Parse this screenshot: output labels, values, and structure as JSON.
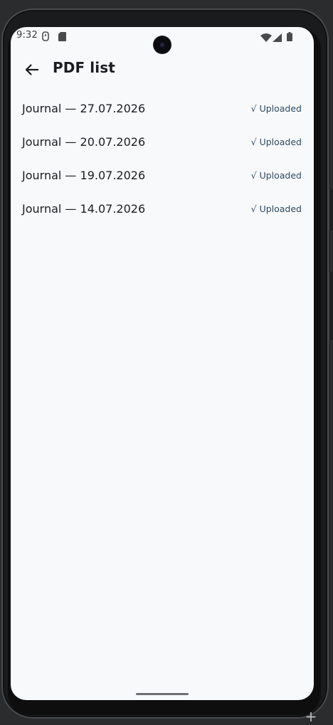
{
  "status_bar": {
    "time": "9:32",
    "left_icons": [
      "usb-icon",
      "sd-card-icon"
    ],
    "right_icons": [
      "wifi-icon",
      "cellular-signal-icon",
      "battery-icon"
    ]
  },
  "app_bar": {
    "back_icon": "arrow-back-icon",
    "title": "PDF list"
  },
  "pdf_list": {
    "items": [
      {
        "title": "Journal — 27.07.2026",
        "status": "√ Uploaded"
      },
      {
        "title": "Journal — 20.07.2026",
        "status": "√ Uploaded"
      },
      {
        "title": "Journal — 19.07.2026",
        "status": "√ Uploaded"
      },
      {
        "title": "Journal — 14.07.2026",
        "status": "√ Uploaded"
      }
    ]
  },
  "colors": {
    "screen_background": "#f8f9fb",
    "text_primary": "#1c1d20",
    "status_text": "#2f4a62"
  }
}
